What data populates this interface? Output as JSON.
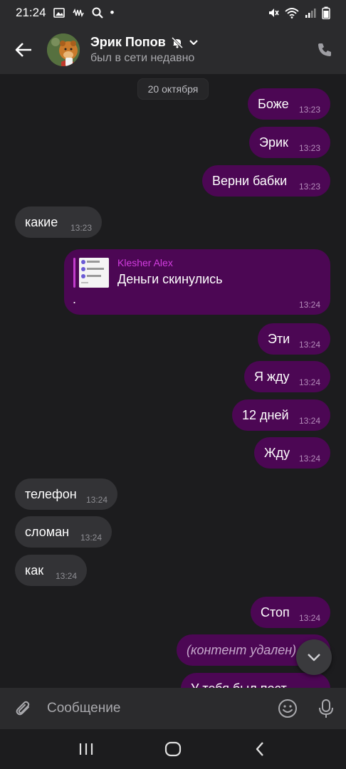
{
  "status_bar": {
    "time": "21:24",
    "dot": "•"
  },
  "header": {
    "name": "Эрик Попов",
    "status": "был в сети недавно"
  },
  "date_chip": "20 октября",
  "messages": [
    {
      "dir": "out",
      "text": "Боже",
      "time": "13:23"
    },
    {
      "dir": "out",
      "text": "Эрик",
      "time": "13:23"
    },
    {
      "dir": "out",
      "text": "Верни бабки",
      "time": "13:23"
    },
    {
      "dir": "in",
      "text": "какие",
      "time": "13:23"
    },
    {
      "dir": "out",
      "type": "reply",
      "reply_author": "Klesher Alex",
      "reply_text": "Деньги скинулись",
      "text": ".",
      "time": "13:24"
    },
    {
      "dir": "out",
      "text": "Эти",
      "time": "13:24"
    },
    {
      "dir": "out",
      "text": "Я жду",
      "time": "13:24"
    },
    {
      "dir": "out",
      "text": "12 дней",
      "time": "13:24"
    },
    {
      "dir": "out",
      "text": "Жду",
      "time": "13:24"
    },
    {
      "dir": "in",
      "text": "телефон",
      "time": "13:24"
    },
    {
      "dir": "in",
      "text": "сломан",
      "time": "13:24"
    },
    {
      "dir": "in",
      "text": "как",
      "time": "13:24"
    },
    {
      "dir": "out",
      "text": "Стоп",
      "time": "13:24"
    },
    {
      "dir": "out",
      "type": "deleted",
      "text": "(контент удален)"
    },
    {
      "dir": "out",
      "text": "У тебя был пост"
    }
  ],
  "composer": {
    "placeholder": "Сообщение"
  },
  "colors": {
    "outgoing": "#4c0754",
    "incoming": "#333336",
    "accent": "#d23ddf",
    "background": "#1c1c1e"
  },
  "icons": [
    "back-arrow-icon",
    "muted-bell-icon",
    "chevron-down-icon",
    "phone-icon",
    "paperclip-icon",
    "emoji-icon",
    "microphone-icon",
    "chevron-down-icon",
    "recent-apps-icon",
    "home-icon",
    "nav-back-icon"
  ]
}
